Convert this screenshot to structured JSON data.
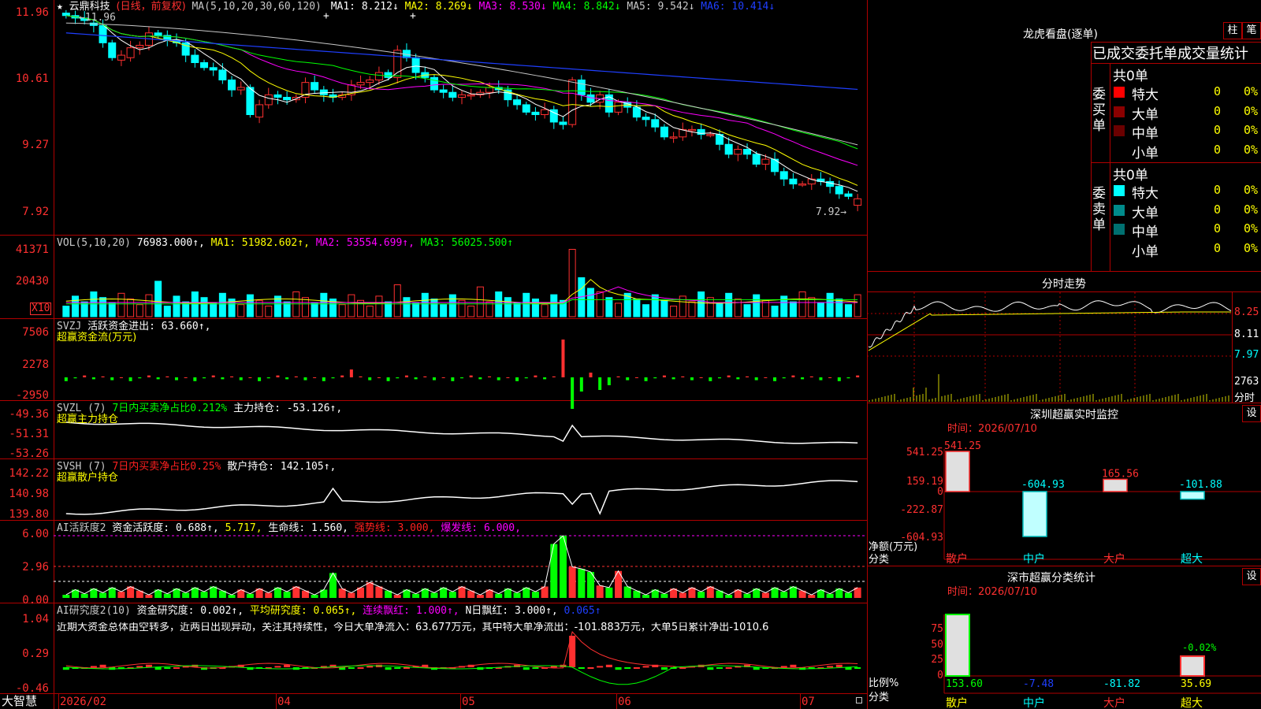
{
  "main": {
    "title_prefix": "★",
    "name": "云鼎科技",
    "period": "(日线，前复权)",
    "ma_def": "MA(5,10,20,30,60,120)",
    "items": [
      {
        "t": "MA1: 8.212↓",
        "c": "#ffffff"
      },
      {
        "t": "MA2: 8.269↓",
        "c": "#ffff00"
      },
      {
        "t": "MA3: 8.530↓",
        "c": "#ff00ff"
      },
      {
        "t": "MA4: 8.842↓",
        "c": "#00ff00"
      },
      {
        "t": "MA5: 9.542↓",
        "c": "#c8c8c8"
      },
      {
        "t": "MA6: 10.414↓",
        "c": "#1f3fff"
      }
    ],
    "axis": [
      "11.96",
      "10.61",
      "9.27",
      "7.92"
    ],
    "high_note": "←11.96",
    "low_note": "7.92→"
  },
  "vol": {
    "items": [
      {
        "t": "VOL(5,10,20)",
        "c": "#c8c8c8"
      },
      {
        "t": "76983.000↑,",
        "c": "#ffffff"
      },
      {
        "t": "MA1: 51982.602↑,",
        "c": "#ffff00"
      },
      {
        "t": "MA2: 53554.699↑,",
        "c": "#ff00ff"
      },
      {
        "t": "MA3: 56025.500↑",
        "c": "#00ff00"
      }
    ],
    "axis": [
      "41371",
      "20430"
    ],
    "unit": "X10"
  },
  "svzj": {
    "items": [
      {
        "t": "SVZJ",
        "c": "#c8c8c8"
      },
      {
        "t": "活跃资金进出: 63.660↑,",
        "c": "#ffffff"
      }
    ],
    "line2": "超赢资金流(万元)",
    "axis": [
      "7506",
      "2278",
      "-2950"
    ]
  },
  "svzl": {
    "items": [
      {
        "t": "SVZL (7)",
        "c": "#c8c8c8"
      },
      {
        "t": "7日内买卖净占比0.212%",
        "c": "#00ff00"
      },
      {
        "t": "主力持仓: -53.126↑,",
        "c": "#ffffff"
      }
    ],
    "line2": "超赢主力持仓",
    "axis": [
      "-49.36",
      "-51.31",
      "-53.26"
    ]
  },
  "svsh": {
    "items": [
      {
        "t": "SVSH (7)",
        "c": "#c8c8c8"
      },
      {
        "t": "7日内买卖净占比0.25%",
        "c": "#ff2020"
      },
      {
        "t": "散户持仓: 142.105↑,",
        "c": "#ffffff"
      }
    ],
    "line2": "超赢散户持仓",
    "axis": [
      "142.22",
      "140.98",
      "139.80"
    ]
  },
  "ai1": {
    "items": [
      {
        "t": "AI活跃度2",
        "c": "#c8c8c8"
      },
      {
        "t": "资金活跃度: 0.688↑,",
        "c": "#ffffff"
      },
      {
        "t": "5.717,",
        "c": "#ffff00"
      },
      {
        "t": "生命线: 1.560,",
        "c": "#ffffff"
      },
      {
        "t": "强势线: 3.000,",
        "c": "#ff2020"
      },
      {
        "t": "爆发线: 6.000,",
        "c": "#ff00ff"
      }
    ],
    "axis": [
      "6.00",
      "2.96",
      "0.00"
    ]
  },
  "ai2": {
    "items": [
      {
        "t": "AI研究度2(10)",
        "c": "#c8c8c8"
      },
      {
        "t": "资金研究度: 0.002↑,",
        "c": "#ffffff"
      },
      {
        "t": "平均研究度: 0.065↑,",
        "c": "#ffff00"
      },
      {
        "t": "连续飘红: 1.000↑,",
        "c": "#ff00ff"
      },
      {
        "t": "N日飘红: 3.000↑,",
        "c": "#ffffff"
      },
      {
        "t": "0.065↑",
        "c": "#1f3fff"
      }
    ],
    "comment": "近期大资金总体由空转多，近两日出现异动，关注其持续性，今日大单净流入：63.677万元，其中特大单净流出：-101.883万元，大单5日累计净出-1010.6",
    "axis": [
      "1.04",
      "0.29",
      "-0.46"
    ]
  },
  "bottom": {
    "brand": "大智慧",
    "dates": [
      "2026/02",
      "04",
      "05",
      "06",
      "07"
    ]
  },
  "right": {
    "btn_zhu": "柱",
    "btn_bi": "笔",
    "longhu_title": "龙虎看盘(逐单)",
    "section_title": "已成交委托单成交量统计",
    "buy_label": "委买单",
    "sell_label": "委卖单",
    "buy_total": "共0单",
    "sell_total": "共0单",
    "buy_rows": [
      {
        "name": "特大",
        "val": "0",
        "pct": "0%",
        "color": "#ff0000"
      },
      {
        "name": "大单",
        "val": "0",
        "pct": "0%",
        "color": "#8b0000"
      },
      {
        "name": "中单",
        "val": "0",
        "pct": "0%",
        "color": "#6a0000"
      },
      {
        "name": "小单",
        "val": "0",
        "pct": "0%",
        "color": "#000000"
      }
    ],
    "sell_rows": [
      {
        "name": "特大",
        "val": "0",
        "pct": "0%",
        "color": "#00ffff"
      },
      {
        "name": "大单",
        "val": "0",
        "pct": "0%",
        "color": "#008b8b"
      },
      {
        "name": "中单",
        "val": "0",
        "pct": "0%",
        "color": "#007070"
      },
      {
        "name": "小单",
        "val": "0",
        "pct": "0%",
        "color": "#000000"
      }
    ],
    "intraday_title": "分时走势",
    "intraday_axis": [
      "8.25",
      "8.11",
      "7.97",
      "2763"
    ],
    "intraday_unit": "分时",
    "sz_title": "深圳超赢实时监控",
    "sz_time": "时间：2026/07/10",
    "sz_axis": [
      "541.25",
      "159.19",
      "0",
      "-222.87",
      "-604.93"
    ],
    "sz_ylabel": "净额(万元)",
    "sz_xlabel": "分类",
    "sz_btn": "设",
    "sz_cats": [
      "散户",
      "中户",
      "大户",
      "超大"
    ],
    "sz_values": [
      541.25,
      -604.93,
      165.56,
      -101.88
    ],
    "sz_value_labels": [
      "541.25",
      "-604.93",
      "165.56",
      "-101.88"
    ],
    "stat_title": "深市超赢分类统计",
    "stat_time": "时间：2026/07/10",
    "stat_axis": [
      "75",
      "50",
      "25",
      "0"
    ],
    "stat_ylabel": "比例%",
    "stat_xlabel": "分类",
    "stat_btn": "设",
    "stat_cats": [
      "散户",
      "中户",
      "大户",
      "超大"
    ],
    "stat_values": [
      153.6,
      -7.48,
      -81.82,
      35.69
    ],
    "stat_value_labels": [
      "153.60",
      "-7.48",
      "-81.82",
      "35.69"
    ],
    "stat_note": "-0.02%"
  },
  "chart_data": {
    "type": "candlestick",
    "title": "云鼎科技(日线，前复权)",
    "ylim": [
      7.92,
      11.96
    ],
    "close": [
      11.9,
      11.85,
      11.8,
      11.7,
      11.35,
      11.05,
      11.1,
      11.25,
      11.3,
      11.55,
      11.5,
      11.4,
      11.35,
      11.1,
      10.95,
      10.85,
      10.8,
      10.6,
      10.4,
      10.45,
      9.9,
      10.1,
      10.3,
      10.25,
      10.2,
      10.25,
      10.55,
      10.4,
      10.3,
      10.25,
      10.3,
      10.5,
      10.55,
      10.6,
      10.75,
      10.65,
      11.2,
      11.05,
      10.75,
      10.65,
      10.4,
      10.35,
      10.25,
      10.3,
      10.3,
      10.35,
      10.45,
      10.4,
      10.2,
      10.1,
      9.95,
      9.9,
      10.0,
      9.75,
      9.7,
      10.6,
      10.3,
      10.15,
      10.3,
      9.95,
      10.15,
      10.05,
      9.85,
      9.8,
      9.65,
      9.45,
      9.45,
      9.6,
      9.6,
      9.5,
      9.5,
      9.3,
      9.1,
      9.2,
      9.1,
      8.9,
      9.0,
      8.75,
      8.6,
      8.5,
      8.5,
      8.6,
      8.55,
      8.45,
      8.3,
      8.25,
      8.2
    ],
    "open": [
      11.95,
      11.9,
      11.85,
      11.75,
      11.7,
      11.35,
      11.0,
      11.05,
      11.25,
      11.3,
      11.55,
      11.5,
      11.4,
      11.35,
      11.1,
      10.95,
      10.85,
      10.8,
      10.6,
      10.4,
      10.45,
      9.85,
      10.1,
      10.3,
      10.25,
      10.2,
      10.25,
      10.55,
      10.4,
      10.3,
      10.25,
      10.3,
      10.5,
      10.55,
      10.6,
      10.75,
      10.65,
      11.2,
      11.05,
      10.75,
      10.65,
      10.4,
      10.35,
      10.25,
      10.3,
      10.3,
      10.35,
      10.45,
      10.4,
      10.2,
      10.1,
      9.95,
      9.9,
      10.0,
      9.75,
      9.7,
      10.6,
      10.3,
      10.15,
      10.3,
      9.95,
      10.15,
      10.05,
      9.85,
      9.8,
      9.65,
      9.45,
      9.45,
      9.6,
      9.6,
      9.5,
      9.5,
      9.3,
      9.1,
      9.2,
      9.1,
      8.9,
      9.0,
      8.75,
      8.6,
      8.5,
      8.5,
      8.6,
      8.55,
      8.45,
      8.3,
      8.07
    ]
  }
}
